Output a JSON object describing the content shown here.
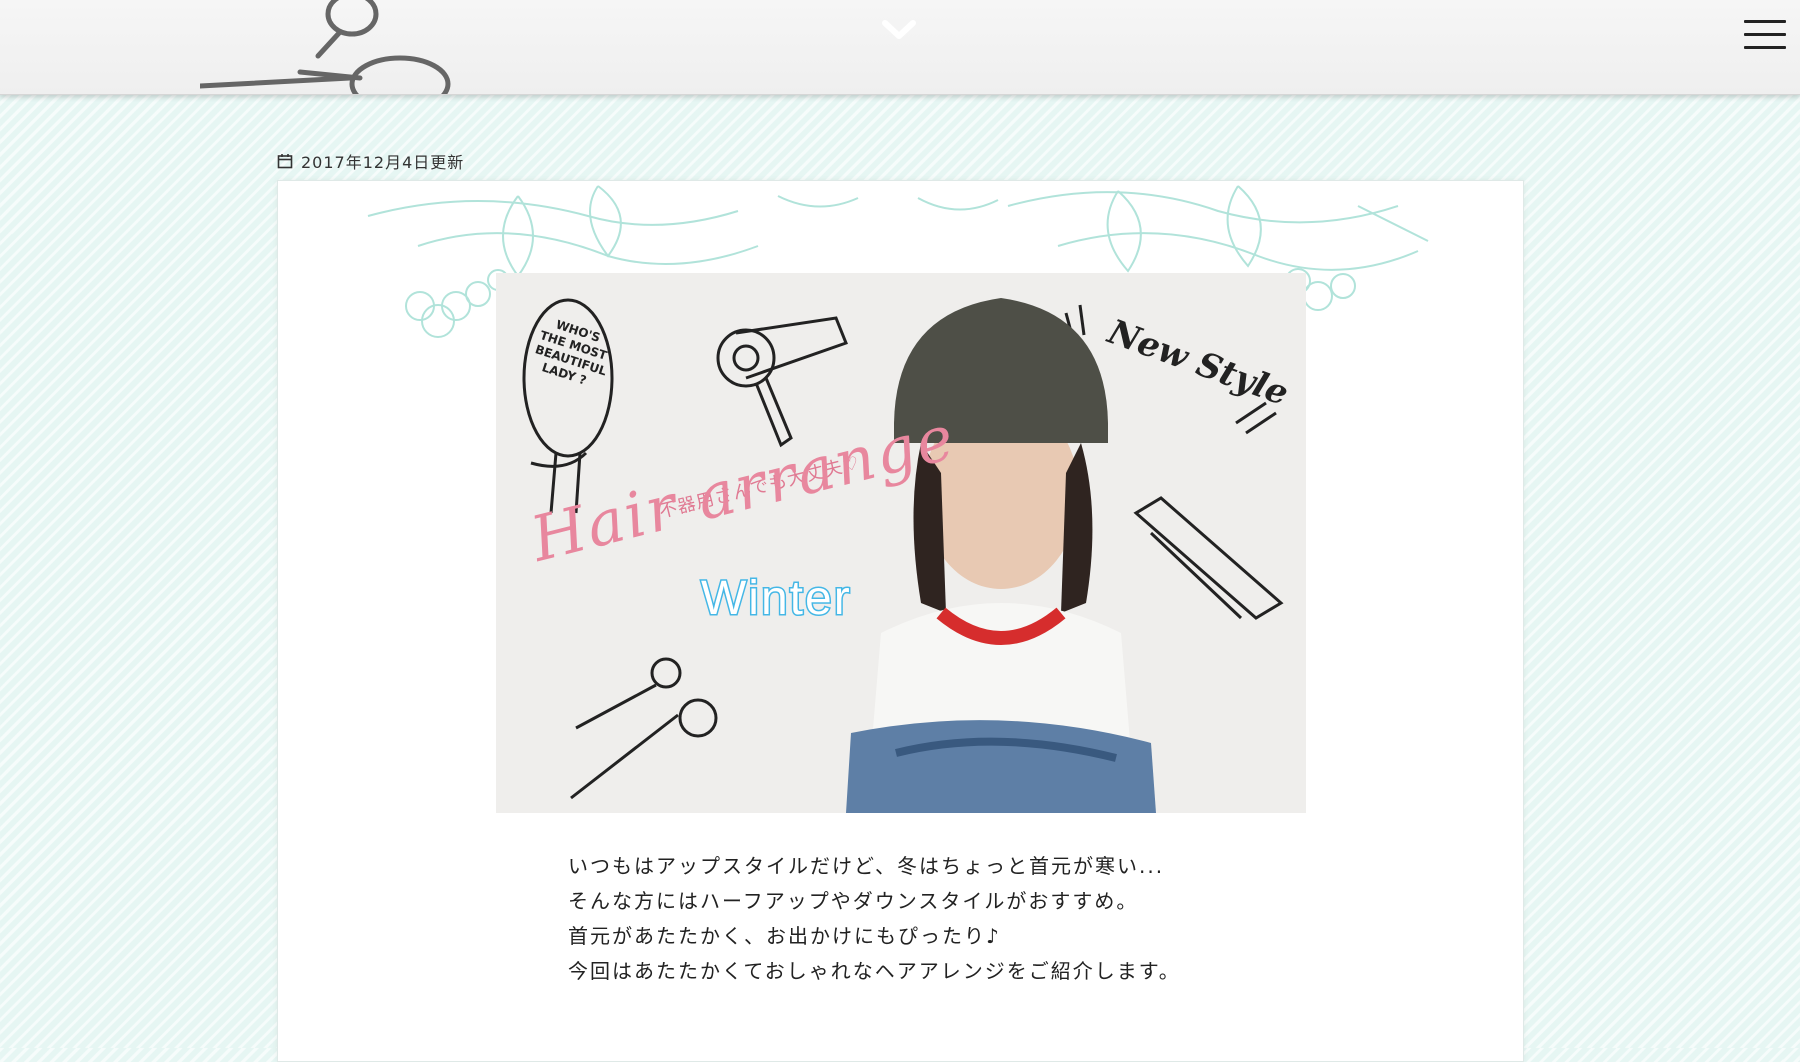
{
  "header": {
    "art_icon": "scissors-sketch-icon",
    "chevron_icon": "chevron-down-icon",
    "menu_icon": "hamburger-menu-icon"
  },
  "article": {
    "date_icon": "calendar-icon",
    "updated": "2017年12月4日更新",
    "hero": {
      "subtitle": "不器用さんでも大丈夫♡",
      "title": "Hair arrange",
      "season": "Winter",
      "badge": "New Style",
      "mirror_text": [
        "WHO'S",
        "THE MOST",
        "BEAUTIFUL",
        "LADY ?"
      ]
    },
    "paragraphs": [
      "いつもはアップスタイルだけど、冬はちょっと首元が寒い...",
      "そんな方にはハーフアップやダウンスタイルがおすすめ。",
      "首元があたたかく、お出かけにもぴったり♪",
      "今回はあたたかくておしゃれなヘアアレンジをご紹介します。"
    ]
  },
  "colors": {
    "page_bg": "#e6f6f3",
    "title_pink": "#e8879e",
    "season_blue": "#44b7e6",
    "floral_mint": "#a9e0d6"
  }
}
